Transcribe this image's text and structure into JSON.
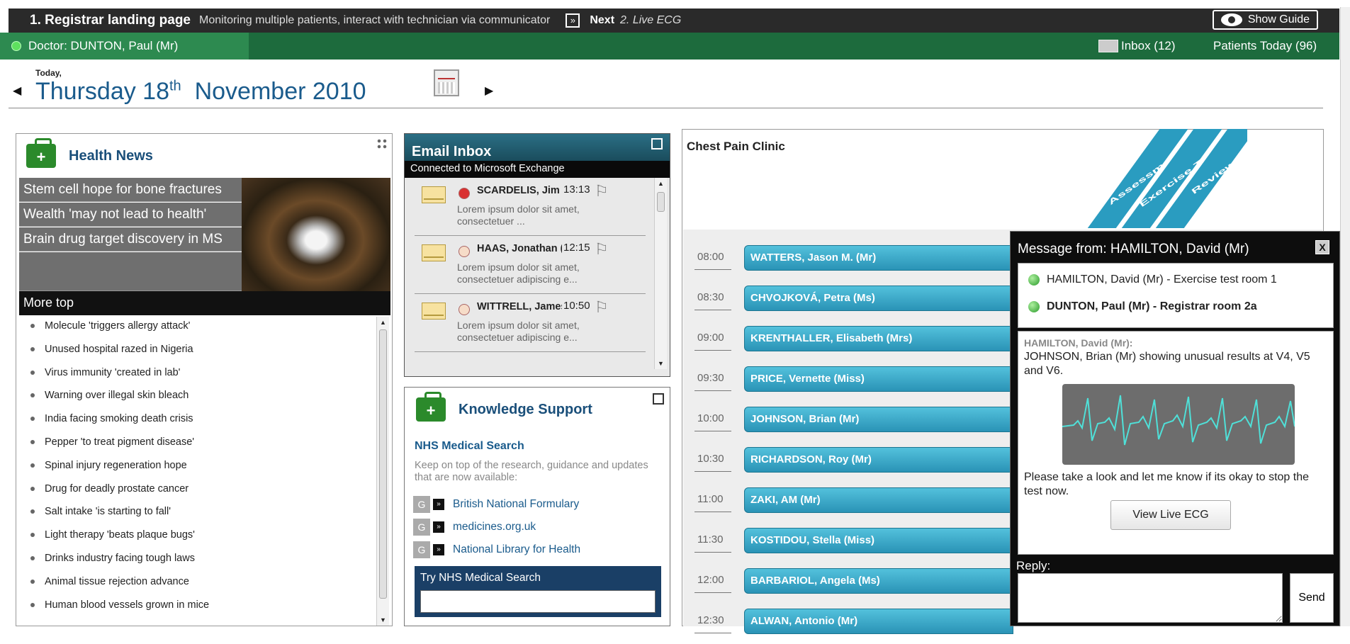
{
  "topbar": {
    "title": "1. Registrar landing page",
    "subtitle": "Monitoring multiple patients, interact with technician via communicator",
    "skip_icon": "»",
    "next_label": "Next",
    "next_target": "2. Live ECG",
    "guide_label": "Show Guide"
  },
  "docbar": {
    "doctor": "Doctor: DUNTON, Paul (Mr)",
    "inbox": "Inbox (12)",
    "patients": "Patients Today (96)"
  },
  "date": {
    "today": "Today,",
    "weekday_day": "Thursday 18",
    "suffix": "th",
    "month_year": "November 2010"
  },
  "health": {
    "title": "Health News",
    "headlines": [
      "Stem cell hope for bone fractures",
      "Wealth 'may not lead to health'",
      "Brain drug target discovery in MS"
    ],
    "more_top": "More top",
    "items": [
      "Molecule 'triggers allergy attack'",
      "Unused hospital razed in Nigeria",
      "Virus immunity 'created in lab'",
      "Warning over illegal skin bleach",
      "India facing smoking death crisis",
      "Pepper 'to treat pigment disease'",
      "Spinal injury regeneration hope",
      "Drug for deadly prostate cancer",
      "Salt intake 'is starting to fall'",
      "Light therapy 'beats plaque bugs'",
      "Drinks industry facing tough laws",
      "Animal tissue rejection advance",
      "Human blood vessels grown in mice"
    ]
  },
  "email": {
    "title": "Email Inbox",
    "connection": "Connected to Microsoft Exchange",
    "messages": [
      {
        "name": "SCARDELIS, Jim (Mr)",
        "time": "13:13",
        "preview": "Lorem ipsum dolor sit amet, consectetuer ...",
        "status": "#d93030"
      },
      {
        "name": "HAAS, Jonathan (Mr)",
        "time": "12:15",
        "preview": "Lorem ipsum dolor sit amet, consectetuer adipiscing e...",
        "status": "#f6dcc8"
      },
      {
        "name": "WITTRELL, James (Mr)",
        "time": "10:50",
        "preview": "Lorem ipsum dolor sit amet, consectetuer adipiscing e...",
        "status": "#f6dcc8"
      }
    ]
  },
  "knowledge": {
    "title": "Knowledge Support",
    "search_title": "NHS Medical Search",
    "desc": "Keep on top of the research, guidance and updates that are now available:",
    "links": [
      "British National Formulary",
      "medicines.org.uk",
      "National Library for Health"
    ],
    "link_prefix": "G",
    "try_label": "Try NHS Medical Search",
    "try_value": ""
  },
  "clinic": {
    "title": "Chest Pain Clinic",
    "stages": [
      "Assessment",
      "Exercise Test",
      "Review"
    ],
    "appointments": [
      {
        "time": "08:00",
        "patient": "WATTERS, Jason M. (Mr)"
      },
      {
        "time": "08:30",
        "patient": "CHVOJKOVÁ, Petra (Ms)"
      },
      {
        "time": "09:00",
        "patient": "KRENTHALLER, Elisabeth (Mrs)"
      },
      {
        "time": "09:30",
        "patient": "PRICE, Vernette (Miss)"
      },
      {
        "time": "10:00",
        "patient": "JOHNSON, Brian (Mr)"
      },
      {
        "time": "10:30",
        "patient": "RICHARDSON, Roy (Mr)"
      },
      {
        "time": "11:00",
        "patient": "ZAKI, AM (Mr)"
      },
      {
        "time": "11:30",
        "patient": "KOSTIDOU, Stella (Miss)"
      },
      {
        "time": "12:00",
        "patient": "BARBARIOL, Angela (Ms)"
      },
      {
        "time": "12:30",
        "patient": "ALWAN, Antonio (Mr)"
      }
    ]
  },
  "message": {
    "header": "Message from: HAMILTON, David (Mr)",
    "close": "X",
    "p1_name": "HAMILTON, David (Mr)",
    "p1_sep": " - ",
    "p1_room": "Exercise test room 1",
    "p2": "DUNTON, Paul (Mr) - Registrar room 2a",
    "from": "HAMILTON, David (Mr):",
    "text": "JOHNSON, Brian (Mr) showing unusual results at V4, V5 and V6.",
    "text2": "Please take a look and let me know if its okay to stop the test now.",
    "button": "View Live ECG",
    "reply_label": "Reply:",
    "reply_value": "",
    "send": "Send"
  },
  "colors": {
    "green": "#1d6b3d",
    "teal": "#2a9cc0",
    "navy": "#1a5b8c",
    "ecg_line": "#4fe0d8"
  }
}
